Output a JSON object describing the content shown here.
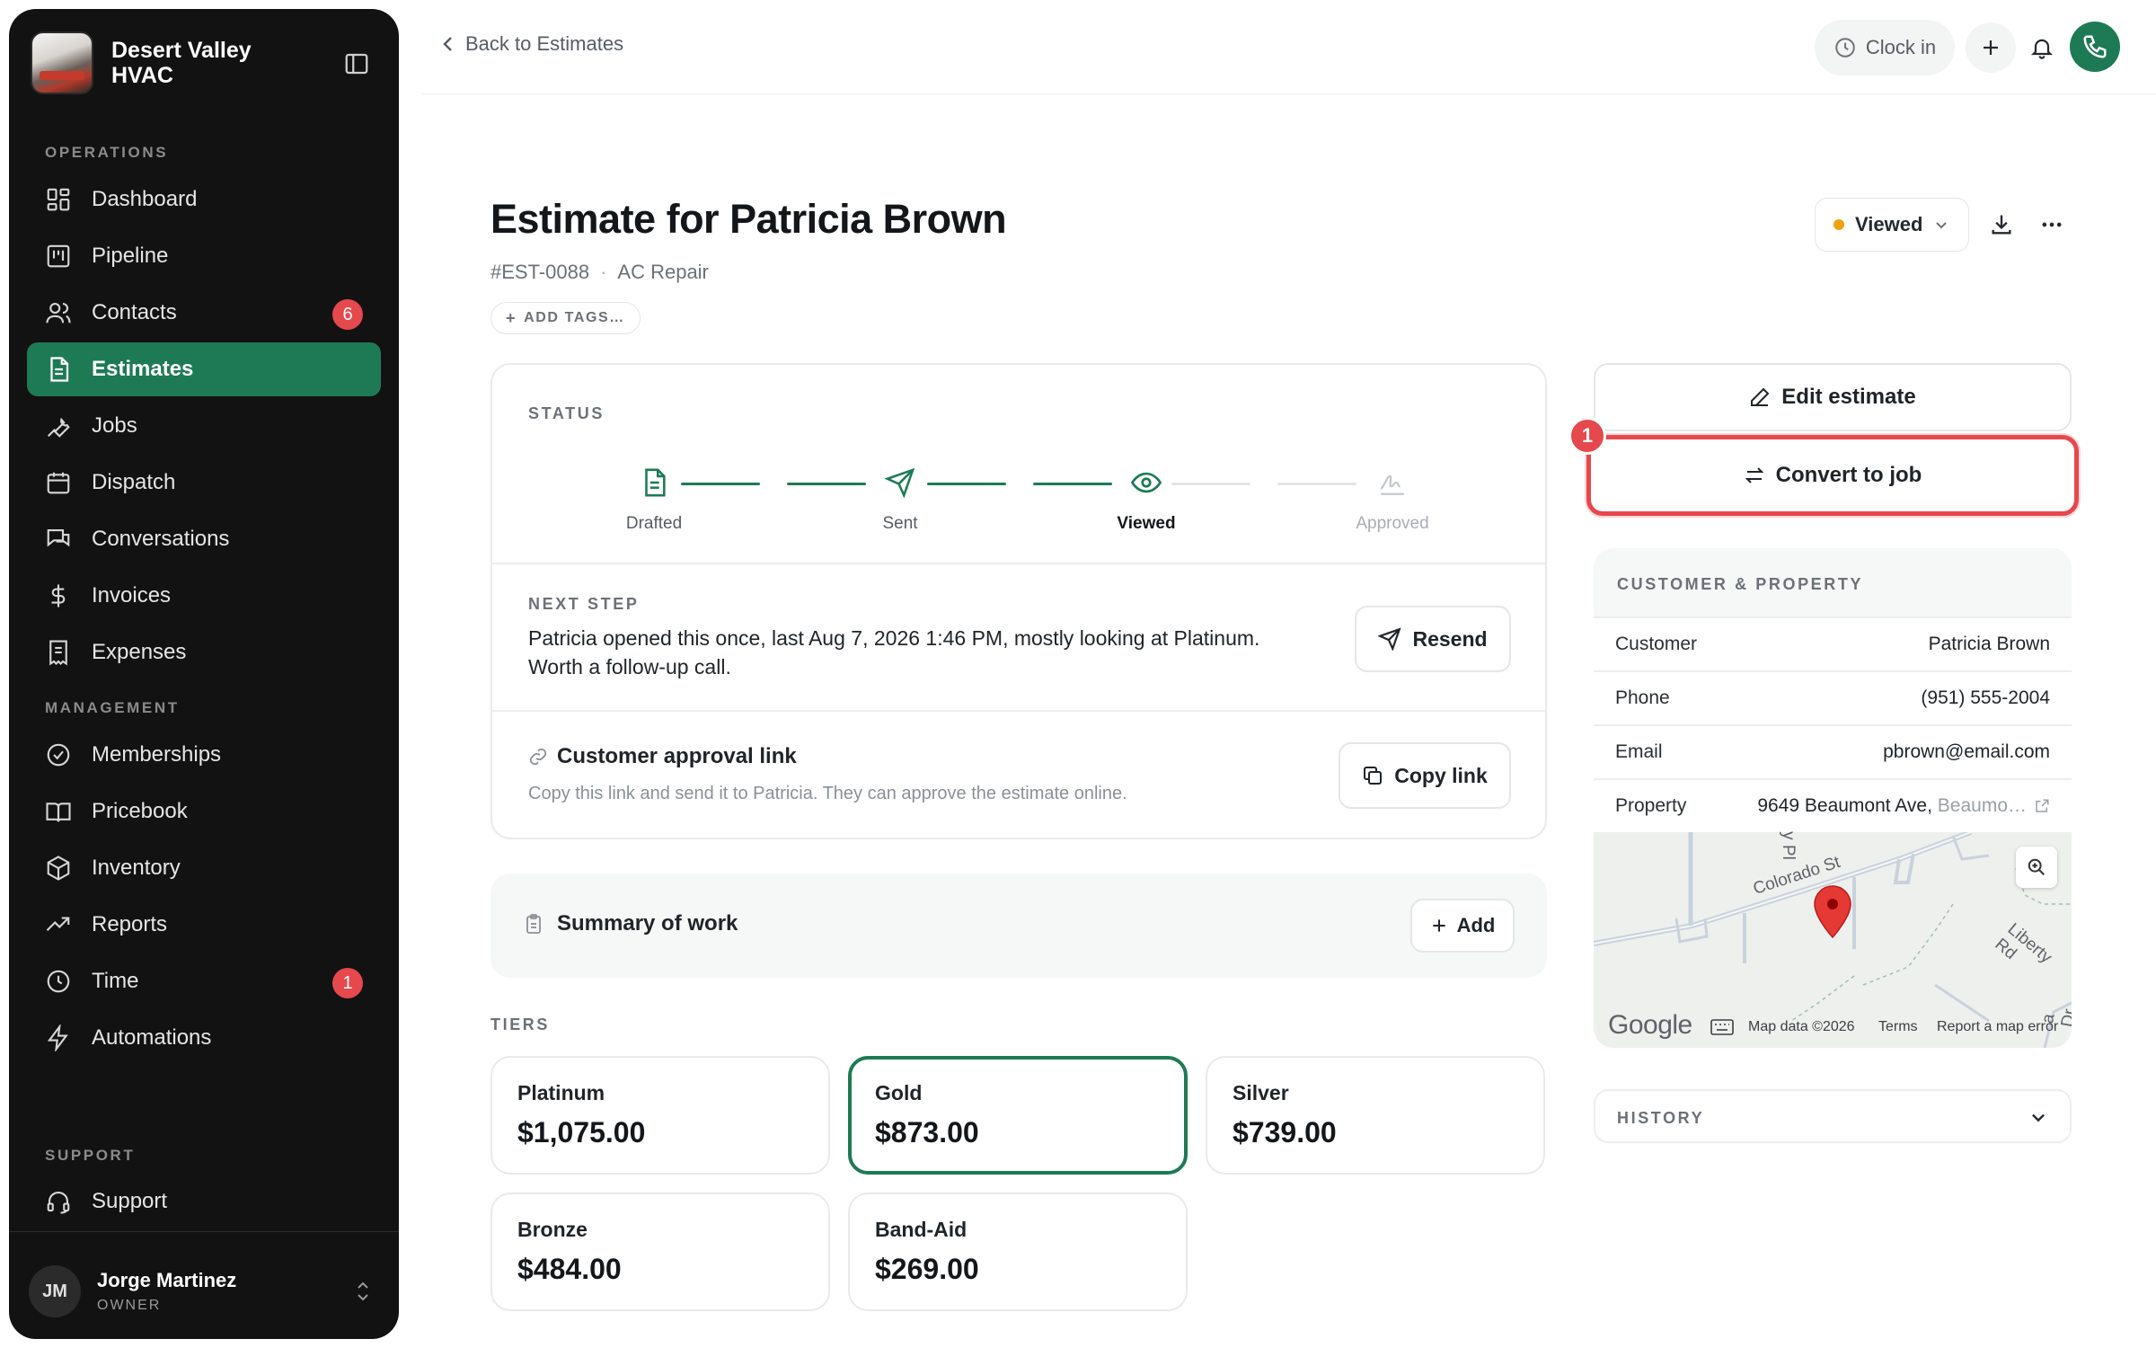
{
  "sidebar": {
    "brand": "Desert Valley HVAC",
    "sections": {
      "operations": "OPERATIONS",
      "management": "MANAGEMENT",
      "support": "SUPPORT"
    },
    "items": {
      "dashboard": {
        "label": "Dashboard",
        "icon": "dashboard-icon"
      },
      "pipeline": {
        "label": "Pipeline",
        "icon": "pipeline-icon"
      },
      "contacts": {
        "label": "Contacts",
        "icon": "contacts-icon",
        "badge": "6"
      },
      "estimates": {
        "label": "Estimates",
        "icon": "estimates-icon",
        "active": true
      },
      "jobs": {
        "label": "Jobs",
        "icon": "wrench-icon"
      },
      "dispatch": {
        "label": "Dispatch",
        "icon": "calendar-icon"
      },
      "conversations": {
        "label": "Conversations",
        "icon": "chat-icon"
      },
      "invoices": {
        "label": "Invoices",
        "icon": "dollar-icon"
      },
      "expenses": {
        "label": "Expenses",
        "icon": "receipt-icon"
      },
      "memberships": {
        "label": "Memberships",
        "icon": "badge-check-icon"
      },
      "pricebook": {
        "label": "Pricebook",
        "icon": "book-icon"
      },
      "inventory": {
        "label": "Inventory",
        "icon": "box-icon"
      },
      "reports": {
        "label": "Reports",
        "icon": "trend-icon"
      },
      "time": {
        "label": "Time",
        "icon": "clock-icon",
        "badge": "1"
      },
      "automations": {
        "label": "Automations",
        "icon": "bolt-icon"
      },
      "support": {
        "label": "Support",
        "icon": "headset-icon"
      }
    },
    "user": {
      "initials": "JM",
      "name": "Jorge Martinez",
      "role": "OWNER"
    }
  },
  "topbar": {
    "back": "Back to Estimates",
    "clock_in": "Clock in"
  },
  "estimate": {
    "title": "Estimate for Patricia Brown",
    "number": "#EST-0088",
    "type": "AC Repair",
    "add_tags": "ADD TAGS…",
    "status": "Viewed",
    "status_color": "#f0a10a"
  },
  "status_card": {
    "label": "STATUS",
    "steps": [
      "Drafted",
      "Sent",
      "Viewed",
      "Approved"
    ],
    "current_step": "Viewed",
    "next_step_label": "NEXT STEP",
    "next_step_text": "Patricia opened this once, last Aug 7, 2026 1:46 PM, mostly looking at Platinum. Worth a follow-up call.",
    "resend": "Resend",
    "approval_title": "Customer approval link",
    "approval_desc": "Copy this link and send it to Patricia. They can approve the estimate online.",
    "copy_link": "Copy link"
  },
  "summary": {
    "title": "Summary of work",
    "add": "Add"
  },
  "tiers": {
    "label": "TIERS",
    "items": [
      {
        "name": "Platinum",
        "price": "$1,075.00"
      },
      {
        "name": "Gold",
        "price": "$873.00",
        "selected": true
      },
      {
        "name": "Silver",
        "price": "$739.00"
      },
      {
        "name": "Bronze",
        "price": "$484.00"
      },
      {
        "name": "Band-Aid",
        "price": "$269.00"
      }
    ]
  },
  "actions": {
    "edit": "Edit estimate",
    "convert": "Convert to job",
    "marker": "1"
  },
  "customer": {
    "label": "CUSTOMER & PROPERTY",
    "rows": {
      "customer": {
        "k": "Customer",
        "v": "Patricia Brown"
      },
      "phone": {
        "k": "Phone",
        "v": "(951) 555-2004"
      },
      "email": {
        "k": "Email",
        "v": "pbrown@email.com"
      },
      "property": {
        "k": "Property",
        "v": "9649 Beaumont Ave,",
        "v2": "Beaumo…"
      }
    },
    "map": {
      "street1": "Colorado St",
      "street2": "Liberty Rd",
      "street3": "y Pl",
      "street4": "a Dr",
      "google": "Google",
      "map_data": "Map data ©2026",
      "terms": "Terms",
      "report": "Report a map error"
    }
  },
  "history": {
    "label": "HISTORY"
  },
  "colors": {
    "accent": "#1d7a55",
    "alert": "#e5484d",
    "sidebar": "#121212"
  }
}
